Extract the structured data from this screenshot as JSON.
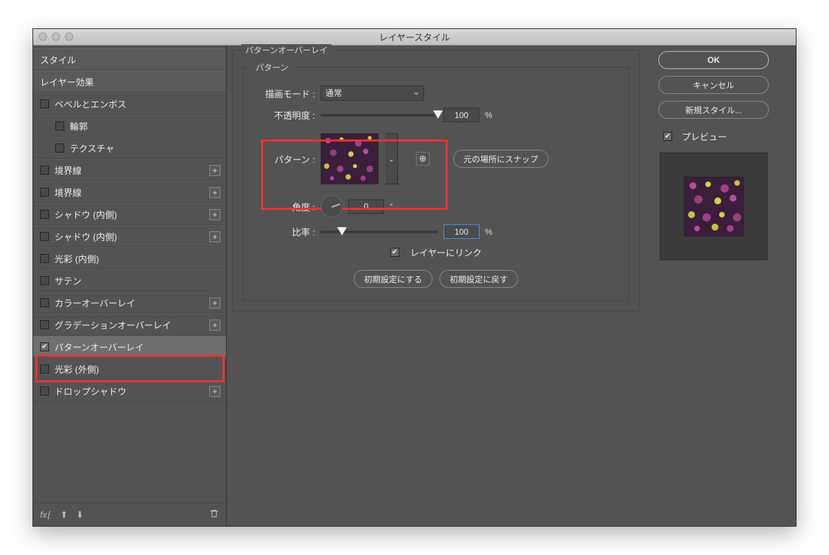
{
  "window": {
    "title": "レイヤースタイル"
  },
  "sidebar": {
    "styles": "スタイル",
    "layerEffects": "レイヤー効果",
    "items": [
      {
        "label": "ベベルとエンボス",
        "checked": false,
        "plus": false
      },
      {
        "label": "輪郭",
        "checked": false,
        "sub": true
      },
      {
        "label": "テクスチャ",
        "checked": false,
        "sub": true
      },
      {
        "label": "境界線",
        "checked": false,
        "plus": true
      },
      {
        "label": "境界線",
        "checked": false,
        "plus": true
      },
      {
        "label": "シャドウ (内側)",
        "checked": false,
        "plus": true
      },
      {
        "label": "シャドウ (内側)",
        "checked": false,
        "plus": true
      },
      {
        "label": "光彩 (内側)",
        "checked": false
      },
      {
        "label": "サテン",
        "checked": false
      },
      {
        "label": "カラーオーバーレイ",
        "checked": false,
        "plus": true
      },
      {
        "label": "グラデーションオーバーレイ",
        "checked": false,
        "plus": true
      },
      {
        "label": "パターンオーバーレイ",
        "checked": true,
        "selected": true,
        "highlight": true
      },
      {
        "label": "光彩 (外側)",
        "checked": false
      },
      {
        "label": "ドロップシャドウ",
        "checked": false,
        "plus": true
      }
    ],
    "fx": "fx"
  },
  "panel": {
    "groupTitle": "パターンオーバーレイ",
    "sectionTitle": "パターン",
    "blendModeLabel": "描画モード :",
    "blendModeValue": "通常",
    "opacityLabel": "不透明度 :",
    "opacityValue": "100",
    "patternLabel": "パターン :",
    "snapLabel": "元の場所にスナップ",
    "angleLabel": "角度 :",
    "angleValue": "0",
    "scaleLabel": "比率 :",
    "scaleValue": "100",
    "linkLabel": "レイヤーにリンク",
    "makeDefault": "初期設定にする",
    "resetDefault": "初期設定に戻す"
  },
  "right": {
    "ok": "OK",
    "cancel": "キャンセル",
    "newStyle": "新規スタイル...",
    "preview": "プレビュー"
  }
}
